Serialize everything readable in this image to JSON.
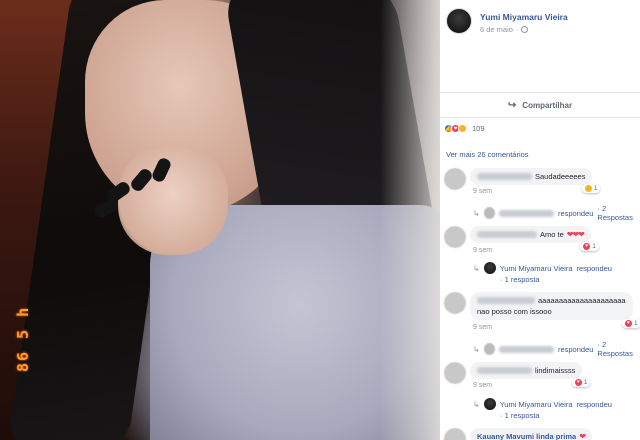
{
  "photo": {
    "date_stamp": "86 5 h"
  },
  "post": {
    "author_name": "Yumi Miyamaru Vieira",
    "date": "6 de maio",
    "share_label": "Compartilhar",
    "reactions_count": "109",
    "view_more": "Ver mais 26 comentários"
  },
  "comments": [
    {
      "text": "Saudadeeeees",
      "time": "9 sem",
      "react_count": "1",
      "reply_action": "respondeu",
      "reply_count": "· 2 Respostas"
    },
    {
      "text": "Amo te",
      "time": "9 sem",
      "react_count": "1",
      "reply_author": "Yumi Miyamaru Vieira",
      "reply_action": "respondeu",
      "reply_count": "· 1 resposta"
    },
    {
      "text_line1": "aaaaaaaaaaaaaaaaaaaaa",
      "text_line2": "nao posso com issooo",
      "time": "9 sem",
      "react_count": "1",
      "reply_action": "respondeu",
      "reply_count": "· 2 Respostas"
    },
    {
      "text": "lindimaissss",
      "time": "9 sem",
      "react_count": "1",
      "reply_author": "Yumi Miyamaru Vieira",
      "reply_action": "respondeu",
      "reply_count": "· 1 resposta"
    },
    {
      "partial": "Kauany Mavumi linda prima"
    }
  ],
  "colors": {
    "link": "#385898",
    "heart": "#f33e58",
    "date_stamp": "#ff9a2a"
  }
}
